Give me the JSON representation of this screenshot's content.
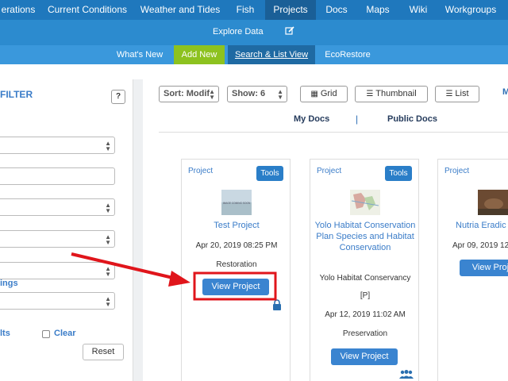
{
  "nav": {
    "top": [
      "erations",
      "Current Conditions",
      "Weather and Tides",
      "Fish",
      "Projects",
      "Docs",
      "Maps",
      "Wiki",
      "Workgroups"
    ],
    "explore": "Explore Data",
    "sub": [
      "What's New",
      "Add New",
      "Search & List View",
      "EcoRestore"
    ]
  },
  "filter": {
    "title": "FILTER",
    "help": "?",
    "tags_label": "ings",
    "results_label": "lts",
    "clear_label": "Clear",
    "reset_label": "Reset"
  },
  "toolbar": {
    "sort": "Sort: Modif",
    "show": "Show: 6",
    "grid": "Grid",
    "thumbnail": "Thumbnail",
    "list": "List",
    "more": "M",
    "my_docs": "My Docs",
    "separator": "|",
    "public_docs": "Public Docs"
  },
  "cards": [
    {
      "type": "Project",
      "tools": "Tools",
      "title": "Test Project",
      "thumb_text": "IMAGE COMING SOON",
      "date": "Apr 20, 2019 08:25 PM",
      "category": "Restoration",
      "view": "View Project"
    },
    {
      "type": "Project",
      "tools": "Tools",
      "title": "Yolo Habitat Conservation Plan Species and Habitat Conservation",
      "org": "Yolo Habitat Conservancy",
      "tag": "[P]",
      "date": "Apr 12, 2019 11:02 AM",
      "category": "Preservation",
      "view": "View Project"
    },
    {
      "type": "Project",
      "title": "Nutria Eradic",
      "date": "Apr 09, 2019 12",
      "view": "View Proje"
    }
  ],
  "colors": {
    "nav": "#1f78bd",
    "nav_active": "#1a5f97",
    "add_new": "#8dc21f",
    "accent": "#3a7cc8",
    "button": "#3a84d0",
    "annotation": "#e0151b"
  }
}
